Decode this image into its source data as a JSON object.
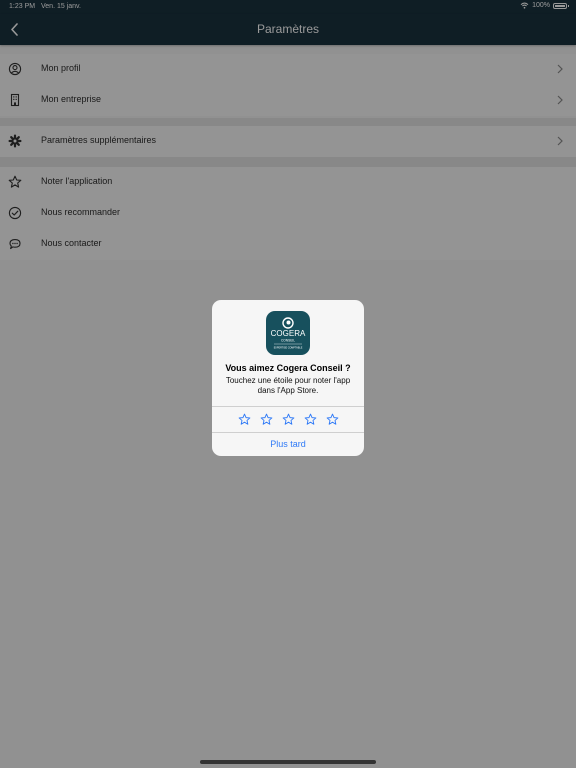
{
  "status": {
    "time": "1:23 PM",
    "date": "Ven. 15 janv.",
    "battery": "100%",
    "battery_level": 1.0
  },
  "nav": {
    "title": "Paramètres",
    "back_icon": "chevron-left-icon"
  },
  "sections": [
    {
      "items": [
        {
          "label": "Mon profil",
          "icon": "user-circle-icon",
          "chevron": true
        },
        {
          "label": "Mon entreprise",
          "icon": "building-icon",
          "chevron": true
        }
      ]
    },
    {
      "items": [
        {
          "label": "Paramètres supplémentaires",
          "icon": "gear-icon",
          "chevron": true
        }
      ]
    },
    {
      "items": [
        {
          "label": "Noter l'application",
          "icon": "star-icon",
          "chevron": false
        },
        {
          "label": "Nous recommander",
          "icon": "check-circle-icon",
          "chevron": false
        },
        {
          "label": "Nous contacter",
          "icon": "chat-bubble-icon",
          "chevron": false
        }
      ]
    }
  ],
  "dialog": {
    "title": "Vous aimez Cogera Conseil ?",
    "message": "Touchez une étoile pour noter l'app dans l'App Store.",
    "star_count": 5,
    "later_label": "Plus tard",
    "app_icon": {
      "brand": "COGERA",
      "sub": "CONSEIL",
      "tagline": "EXPERTISE COMPTABLE",
      "bg_color": "#17505d"
    }
  },
  "colors": {
    "nav_bg": "#19323e",
    "accent_blue": "#2f7af7"
  }
}
